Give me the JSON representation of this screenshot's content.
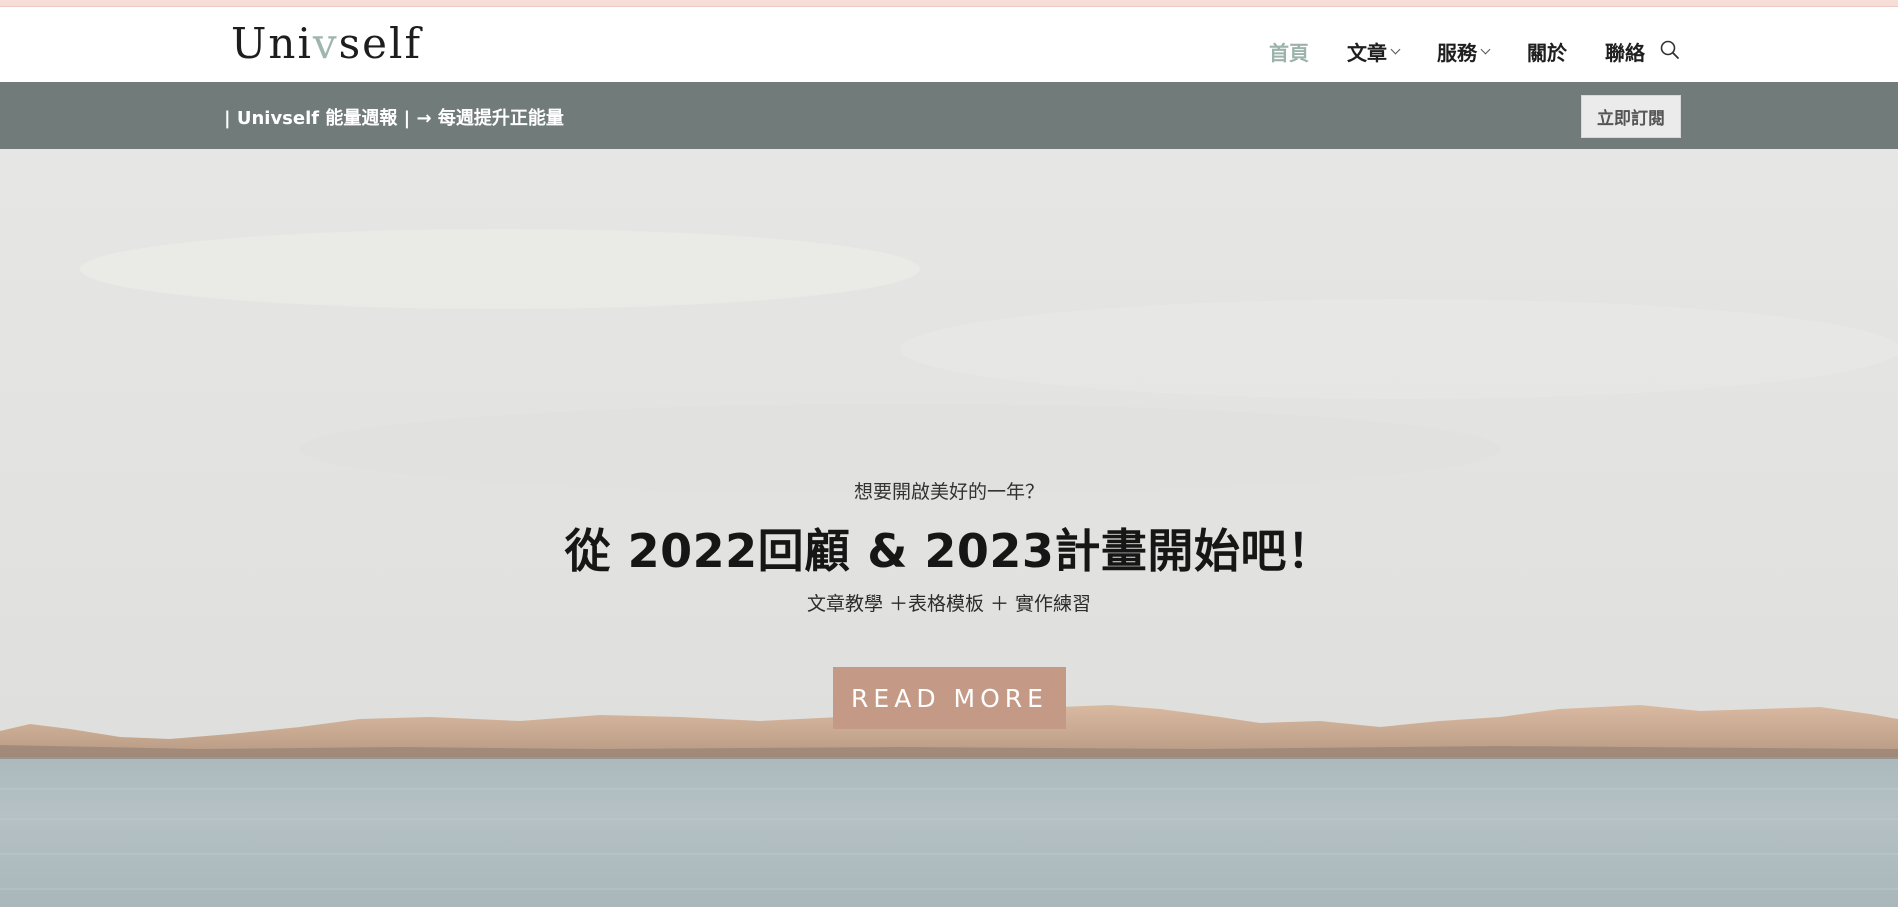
{
  "header": {
    "logo_text_pre": "Uni",
    "logo_text_accent": "v",
    "logo_text_post": "self",
    "nav": [
      {
        "label": "首頁",
        "active": true,
        "has_dropdown": false
      },
      {
        "label": "文章",
        "active": false,
        "has_dropdown": true
      },
      {
        "label": "服務",
        "active": false,
        "has_dropdown": true
      },
      {
        "label": "關於",
        "active": false,
        "has_dropdown": false
      },
      {
        "label": "聯絡",
        "active": false,
        "has_dropdown": false
      }
    ],
    "search_icon": "search-icon"
  },
  "announcement": {
    "text": "| Univself 能量週報 | → 每週提升正能量",
    "button_label": "立即訂閱"
  },
  "hero": {
    "eyebrow": "想要開啟美好的一年？",
    "headline": "從 2022回顧 & 2023計畫開始吧！",
    "subline": "文章教學 ＋表格模板 ＋ 實作練習",
    "button_label": "READ MORE"
  },
  "colors": {
    "accent": "#9cb3ab",
    "announcement_bg": "#717b7a",
    "button_bg": "#c49a86",
    "top_strip": "#f6ddd8"
  }
}
